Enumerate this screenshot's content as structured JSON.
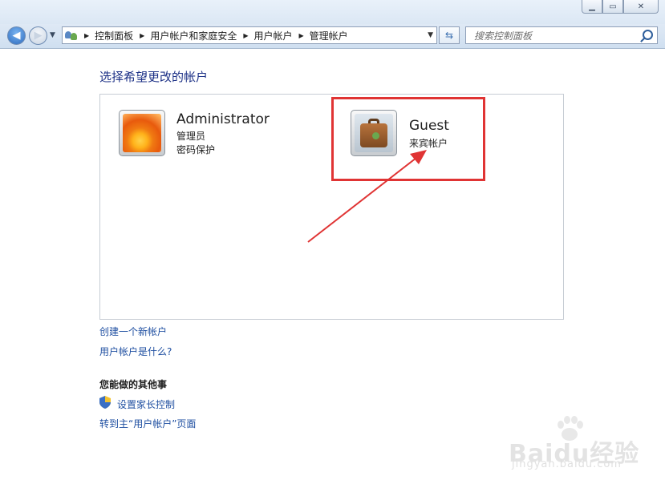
{
  "window": {
    "title_faint": "",
    "buttons": [
      "minimize",
      "maximize",
      "close"
    ]
  },
  "navigation": {
    "breadcrumbs": [
      "控制面板",
      "用户帐户和家庭安全",
      "用户帐户",
      "管理帐户"
    ],
    "search_placeholder": "搜索控制面板"
  },
  "main": {
    "title": "选择希望更改的帐户",
    "accounts": [
      {
        "name": "Administrator",
        "lines": [
          "管理员",
          "密码保护"
        ],
        "icon": "flower-picture"
      },
      {
        "name": "Guest",
        "lines": [
          "来宾帐户"
        ],
        "icon": "suitcase-picture"
      }
    ],
    "links": [
      "创建一个新帐户",
      "用户帐户是什么?"
    ],
    "other_heading": "您能做的其他事",
    "other_links": [
      "设置家长控制",
      "转到主“用户帐户”页面"
    ]
  },
  "annotation": {
    "color": "#e03434"
  },
  "watermark": {
    "brand": "Baidu经验",
    "url": "jingyan.baidu.com"
  }
}
